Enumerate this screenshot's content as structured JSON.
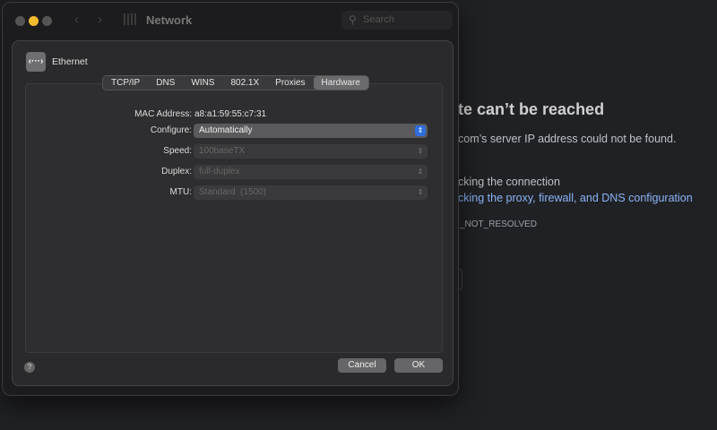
{
  "background_page": {
    "heading": "te can’t be reached",
    "message": "com’s server IP address could not be found.",
    "suggestion1": "cking the connection",
    "suggestion2": "cking the proxy, firewall, and DNS configuration",
    "error_code": "_NOT_RESOLVED"
  },
  "window": {
    "title": "Network",
    "search_placeholder": "Search"
  },
  "sheet": {
    "service": "Ethernet",
    "service_icon": "‹···›",
    "tabs": [
      {
        "label": "TCP/IP"
      },
      {
        "label": "DNS"
      },
      {
        "label": "WINS"
      },
      {
        "label": "802.1X"
      },
      {
        "label": "Proxies"
      },
      {
        "label": "Hardware",
        "active": true
      }
    ],
    "mac_label": "MAC Address:",
    "mac_value": "a8:a1:59:55:c7:31",
    "configure_label": "Configure:",
    "configure_value": "Automatically",
    "speed_label": "Speed:",
    "speed_value": "100baseTX",
    "duplex_label": "Duplex:",
    "duplex_value": "full-duplex",
    "mtu_label": "MTU:",
    "mtu_value": "Standard  (1500)",
    "help": "?",
    "cancel": "Cancel",
    "ok": "OK"
  },
  "colors": {
    "accent": "#2d6ee0",
    "link": "#8ab4f8"
  }
}
